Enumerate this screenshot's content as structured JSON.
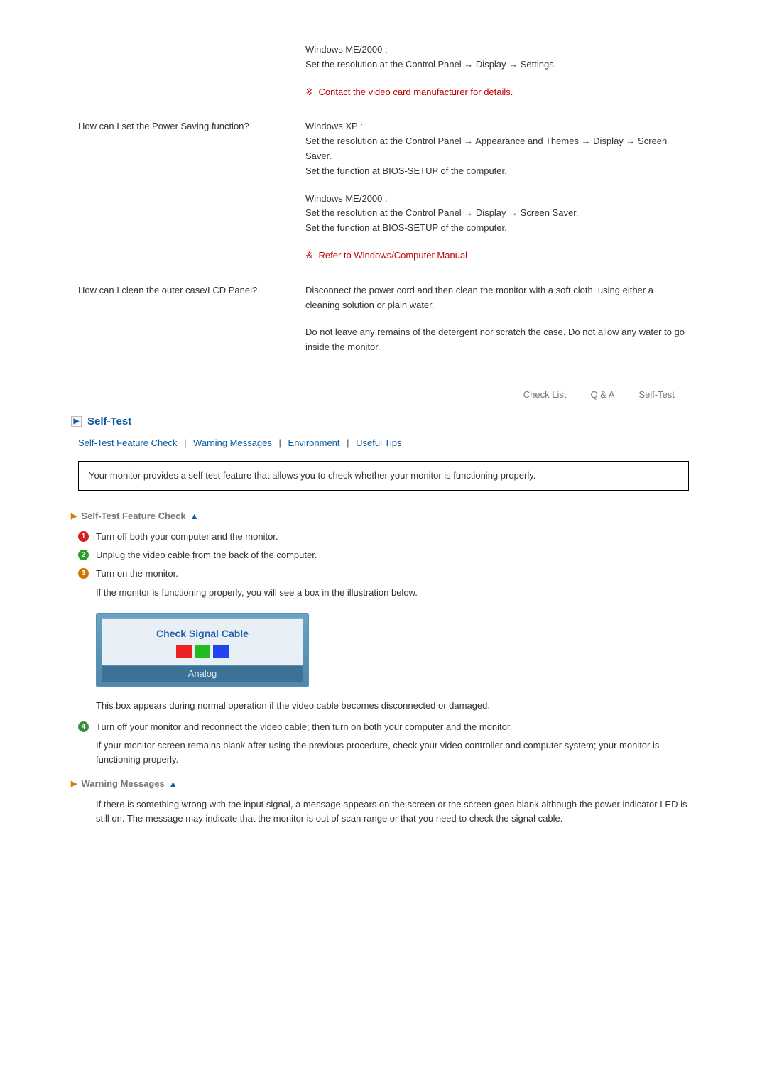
{
  "qa": {
    "previous_answer": {
      "block1_line1": "Windows ME/2000 :",
      "block1_line2": "Set the resolution at the Control Panel → Display → Settings.",
      "note": "Contact the video card manufacturer for details."
    },
    "row1": {
      "question": "How can I set the Power Saving function?",
      "block1_line1": "Windows XP :",
      "block1_line2": "Set the resolution at the Control Panel → Appearance and Themes → Display → Screen Saver.",
      "block1_line3": "Set the function at BIOS-SETUP of the computer.",
      "block2_line1": "Windows ME/2000 :",
      "block2_line2": "Set the resolution at the Control Panel → Display → Screen Saver.",
      "block2_line3": "Set the function at BIOS-SETUP of the computer.",
      "note": "Refer to Windows/Computer Manual"
    },
    "row2": {
      "question": "How can I clean the outer case/LCD Panel?",
      "block1": "Disconnect the power cord and then clean the monitor with a soft cloth, using either a cleaning solution or plain water.",
      "block2": "Do not leave any remains of the detergent nor scratch the case. Do not allow any water to go inside the monitor."
    }
  },
  "tabs": {
    "t1": "Check List",
    "t2": "Q & A",
    "t3": "Self-Test"
  },
  "section": {
    "title": "Self-Test",
    "link1": "Self-Test Feature Check",
    "link2": "Warning Messages",
    "link3": "Environment",
    "link4": "Useful Tips",
    "intro": "Your monitor provides a self test feature that allows you to check whether your monitor is functioning properly."
  },
  "selftest": {
    "heading": "Self-Test Feature Check",
    "step1": "Turn off both your computer and the monitor.",
    "step2": "Unplug the video cable from the back of the computer.",
    "step3": "Turn on the monitor.",
    "step3b": "If the monitor is functioning properly, you will see a box in the illustration below.",
    "ill_label": "Check Signal Cable",
    "ill_bottom": "Analog",
    "after_ill": "This box appears during normal operation if the video cable becomes disconnected or damaged.",
    "step4": "Turn off your monitor and reconnect the video cable; then turn on both your computer and the monitor.",
    "step4b": "If your monitor screen remains blank after using the previous procedure, check your video controller and computer system; your monitor is functioning properly."
  },
  "warning": {
    "heading": "Warning Messages",
    "text": "If there is something wrong with the input signal, a message appears on the screen or the screen goes blank although the power indicator LED is still on. The message may indicate that the monitor is out of scan range or that you need to check the signal cable."
  }
}
